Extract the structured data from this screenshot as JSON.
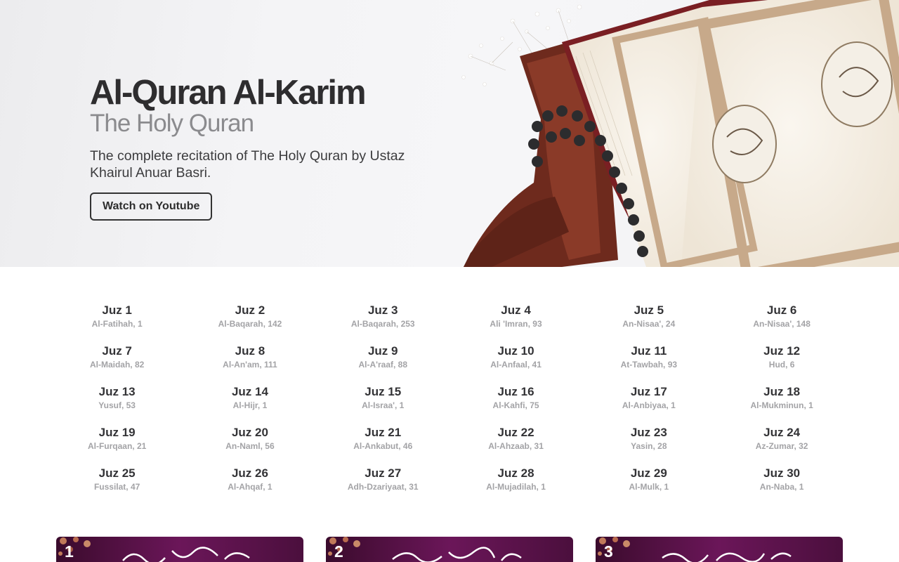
{
  "hero": {
    "title": "Al-Quran Al-Karim",
    "subtitle": "The Holy Quran",
    "description": "The complete recitation of The Holy Quran by Ustaz Khairul Anuar Basri.",
    "button_label": "Watch on Youtube"
  },
  "juz": [
    {
      "name": "Juz 1",
      "start": "Al-Fatihah, 1"
    },
    {
      "name": "Juz 2",
      "start": "Al-Baqarah, 142"
    },
    {
      "name": "Juz 3",
      "start": "Al-Baqarah, 253"
    },
    {
      "name": "Juz 4",
      "start": "Ali 'Imran, 93"
    },
    {
      "name": "Juz 5",
      "start": "An-Nisaa', 24"
    },
    {
      "name": "Juz 6",
      "start": "An-Nisaa', 148"
    },
    {
      "name": "Juz 7",
      "start": "Al-Maidah, 82"
    },
    {
      "name": "Juz 8",
      "start": "Al-An'am, 111"
    },
    {
      "name": "Juz 9",
      "start": "Al-A'raaf, 88"
    },
    {
      "name": "Juz 10",
      "start": "Al-Anfaal, 41"
    },
    {
      "name": "Juz 11",
      "start": "At-Tawbah, 93"
    },
    {
      "name": "Juz 12",
      "start": "Hud, 6"
    },
    {
      "name": "Juz 13",
      "start": "Yusuf, 53"
    },
    {
      "name": "Juz 14",
      "start": "Al-Hijr, 1"
    },
    {
      "name": "Juz 15",
      "start": "Al-Israa', 1"
    },
    {
      "name": "Juz 16",
      "start": "Al-Kahfi, 75"
    },
    {
      "name": "Juz 17",
      "start": "Al-Anbiyaa, 1"
    },
    {
      "name": "Juz 18",
      "start": "Al-Mukminun, 1"
    },
    {
      "name": "Juz 19",
      "start": "Al-Furqaan, 21"
    },
    {
      "name": "Juz 20",
      "start": "An-Naml, 56"
    },
    {
      "name": "Juz 21",
      "start": "Al-Ankabut, 46"
    },
    {
      "name": "Juz 22",
      "start": "Al-Ahzaab, 31"
    },
    {
      "name": "Juz 23",
      "start": "Yasin, 28"
    },
    {
      "name": "Juz 24",
      "start": "Az-Zumar, 32"
    },
    {
      "name": "Juz 25",
      "start": "Fussilat, 47"
    },
    {
      "name": "Juz 26",
      "start": "Al-Ahqaf, 1"
    },
    {
      "name": "Juz 27",
      "start": "Adh-Dzariyaat, 31"
    },
    {
      "name": "Juz 28",
      "start": "Al-Mujadilah, 1"
    },
    {
      "name": "Juz 29",
      "start": "Al-Mulk, 1"
    },
    {
      "name": "Juz 30",
      "start": "An-Naba, 1"
    }
  ],
  "cards": [
    {
      "number": "1"
    },
    {
      "number": "2"
    },
    {
      "number": "3"
    }
  ],
  "colors": {
    "accent_dark": "#2e2d2f",
    "muted": "#a3a3a6",
    "card_purple": "#6b1659"
  }
}
